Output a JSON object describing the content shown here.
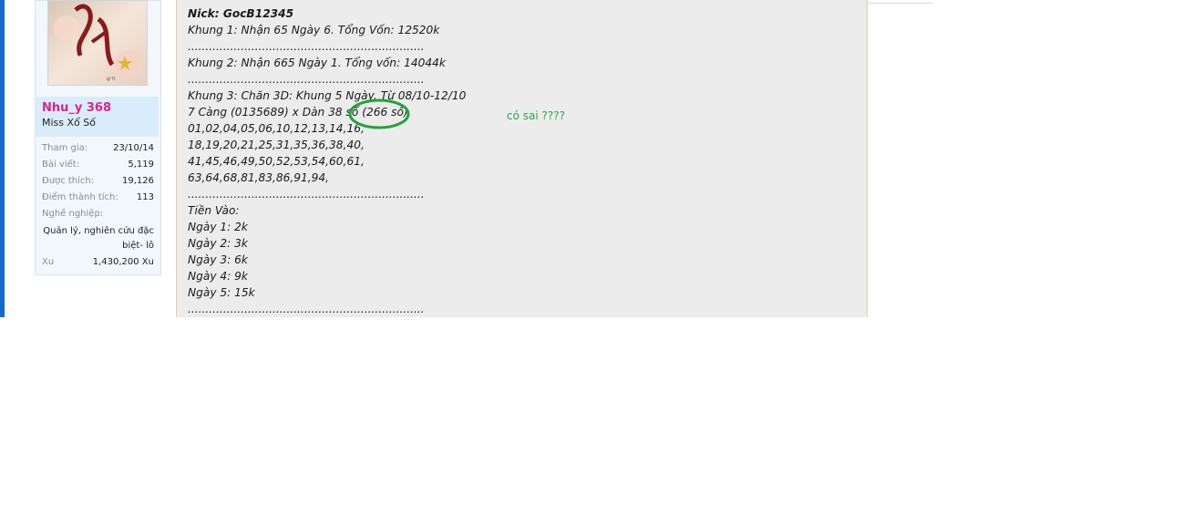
{
  "user": {
    "name": "Nhu_y 368",
    "title": "Miss Xổ Số",
    "stats": [
      {
        "label": "Tham gia:",
        "value": "23/10/14"
      },
      {
        "label": "Bài viết:",
        "value": "5,119"
      },
      {
        "label": "Được thích:",
        "value": "19,126"
      },
      {
        "label": "Điểm thành tích:",
        "value": "113"
      }
    ],
    "occupation_label": "Nghề nghiệp:",
    "occupation_value_line1": "Quản lý, nghiên cứu đặc",
    "occupation_value_line2": "biệt- lô",
    "xu_label": "Xu",
    "xu_value": "1,430,200 Xu"
  },
  "post": {
    "lines": [
      "Nick: GocB12345",
      "Khung 1: Nhận 65 Ngày 6. Tổng Vốn: 12520k",
      "...................................................................",
      "Khung 2: Nhận 665 Ngày 1. Tổng vốn: 14044k",
      "...................................................................",
      "Khung 3: Chăn 3D: Khung 5 Ngày. Từ 08/10-12/10",
      "7 Càng (0135689) x Dàn 38 số (266 số)",
      "01,02,04,05,06,10,12,13,14,16,",
      "18,19,20,21,25,31,35,36,38,40,",
      "41,45,46,49,50,52,53,54,60,61,",
      "63,64,68,81,83,86,91,94,",
      "...................................................................",
      "Tiền Vào:",
      "Ngày 1: 2k",
      "Ngày 2: 3k",
      "Ngày 3: 6k",
      "Ngày 4: 9k",
      "Ngày 5: 15k",
      "..................................................................."
    ]
  },
  "annotation": {
    "comment": "có sai ????",
    "ring_color": "#22a33a",
    "comment_color": "#27a843"
  },
  "colors": {
    "accent_bar": "#1569c7",
    "username": "#e0218a",
    "post_bg": "#ececec"
  }
}
